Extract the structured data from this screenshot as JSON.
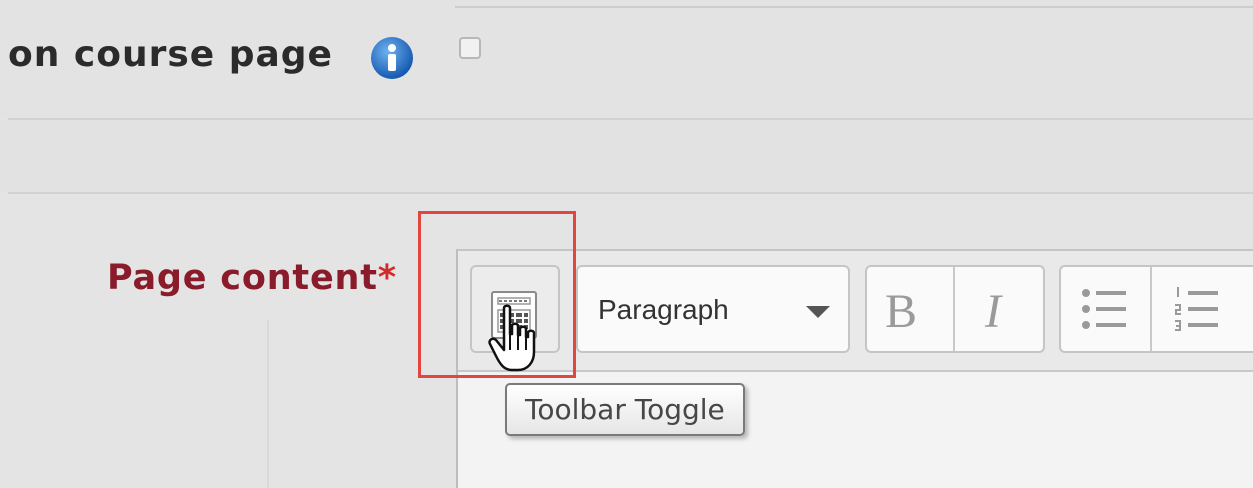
{
  "settings": {
    "display_label": "on course page",
    "info_icon": "info-icon",
    "checkbox_checked": false
  },
  "field": {
    "label": "Page content",
    "required_mark": "*"
  },
  "editor": {
    "toolbar": {
      "toggle_icon": "toolbar-toggle-icon",
      "paragraph_select": "Paragraph",
      "bold_label": "B",
      "italic_label": "I",
      "unordered_list_icon": "bullet-list-icon",
      "ordered_list_icon": "numbered-list-icon"
    },
    "tooltip": "Toolbar Toggle"
  },
  "colors": {
    "required_label": "#8a1b2a",
    "required_star": "#d12b2b",
    "highlight": "#e2463f",
    "info": "#1f6fc5"
  }
}
